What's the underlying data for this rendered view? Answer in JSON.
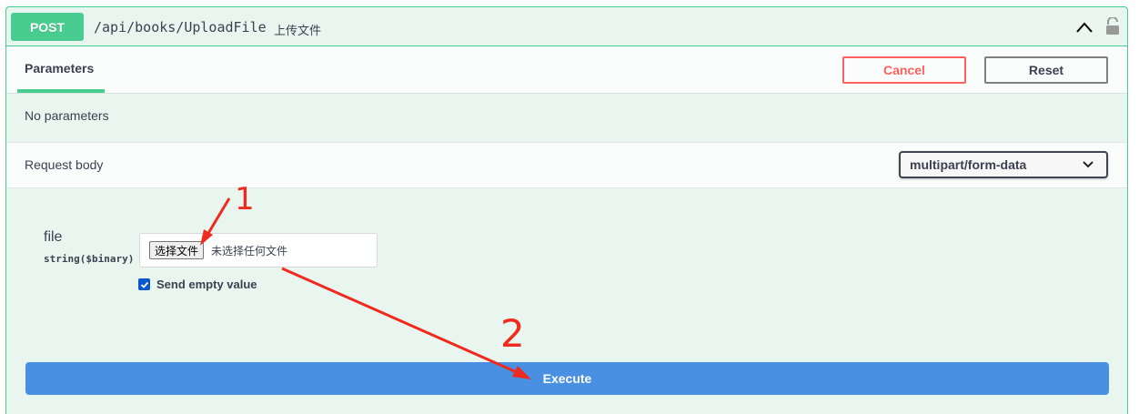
{
  "operation": {
    "method": "POST",
    "path": "/api/books/UploadFile",
    "description": "上传文件"
  },
  "parameters_section": {
    "tab_label": "Parameters",
    "cancel_label": "Cancel",
    "reset_label": "Reset",
    "no_params_text": "No parameters"
  },
  "request_body": {
    "label": "Request body",
    "content_type": "multipart/form-data",
    "param_name": "file",
    "param_type": "string($binary)",
    "file_button_label": "选择文件",
    "file_status": "未选择任何文件",
    "send_empty_label": "Send empty value",
    "send_empty_checked": true
  },
  "execute_label": "Execute",
  "annotations": {
    "label_1": "1",
    "label_2": "2",
    "color": "#f02a1e"
  },
  "colors": {
    "post_green": "#49cc90",
    "block_bg": "#e8f6ef",
    "cancel_red": "#ff6060",
    "execute_blue": "#4990e2"
  }
}
